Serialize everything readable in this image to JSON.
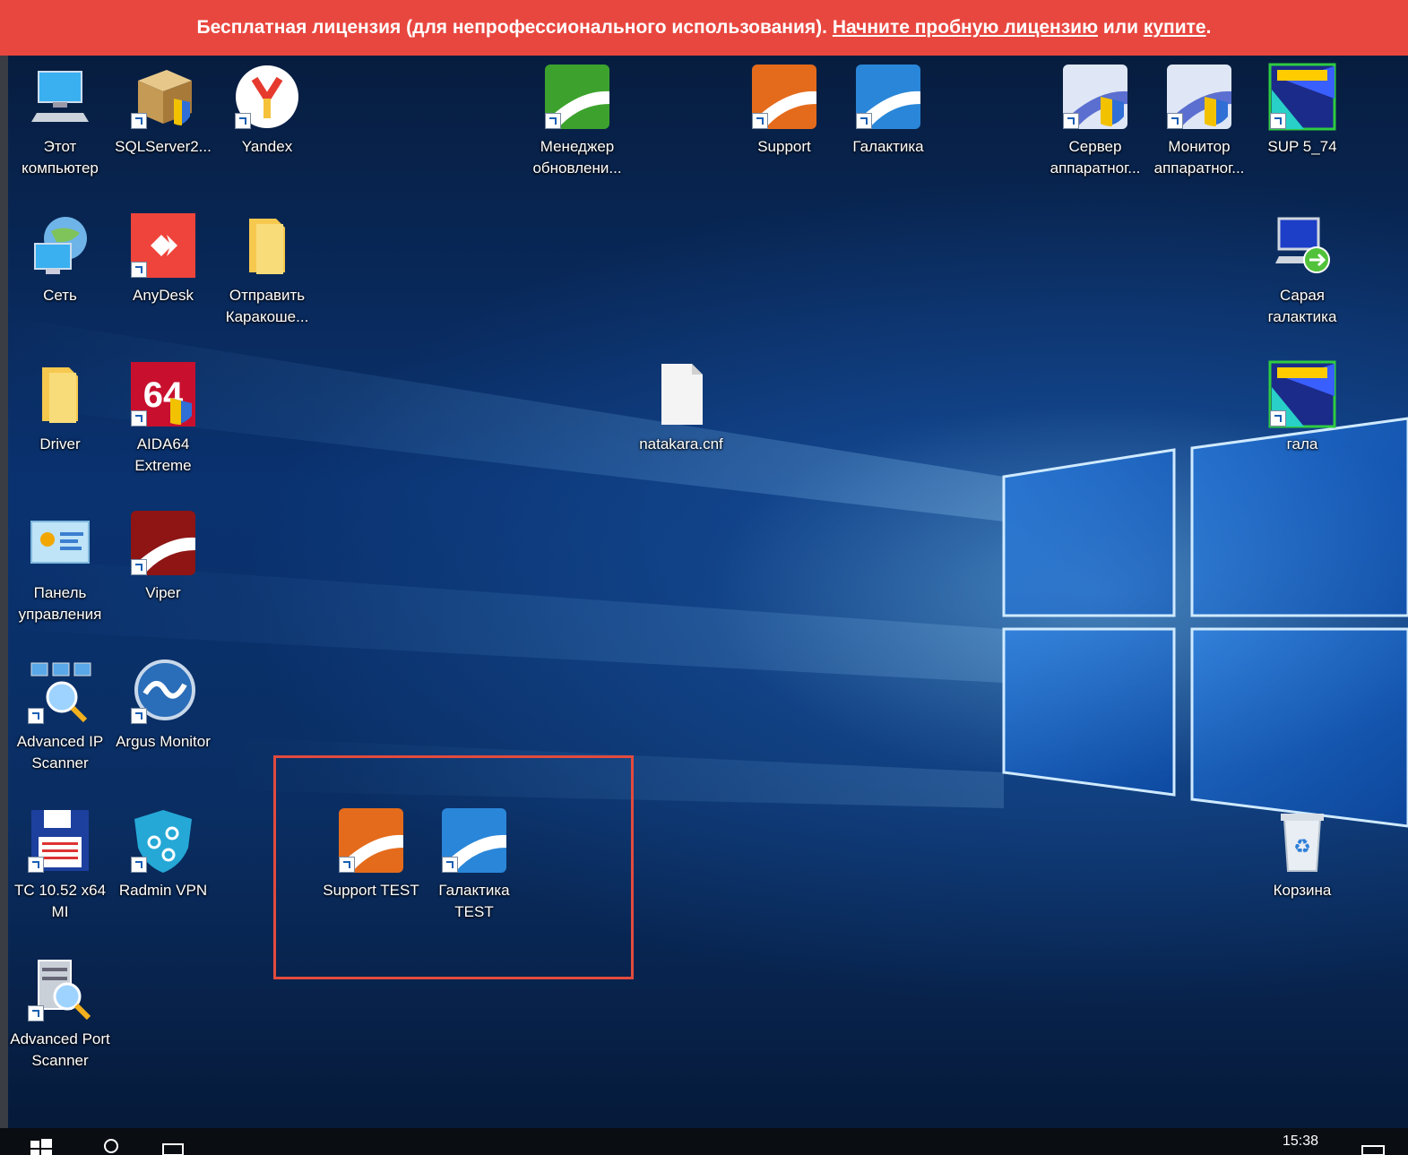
{
  "banner": {
    "text_pre": "Бесплатная лицензия (для непрофессионального использования). ",
    "link_trial": "Начните пробную лицензию",
    "text_mid": " или ",
    "link_buy": "купите",
    "text_post": "."
  },
  "desktop": {
    "icons": {
      "this_pc": "Этот компьютер",
      "sqlserver": "SQLServer2...",
      "yandex": "Yandex",
      "update_manager": "Менеджер обновлени...",
      "support": "Support",
      "galaktika": "Галактика",
      "hw_server": "Сервер аппаратног...",
      "hw_monitor": "Монитор аппаратног...",
      "sup574": "SUP 5_74",
      "network": "Сеть",
      "anydesk": "AnyDesk",
      "send_karakoshe": "Отправить Каракоше...",
      "saraya_galaktika": "Сарая галактика",
      "driver": "Driver",
      "aida64": "AIDA64 Extreme",
      "natakara": "natakara.cnf",
      "gala": "гала",
      "control_panel": "Панель управления",
      "viper": "Viper",
      "advanced_ip": "Advanced IP Scanner",
      "argus": "Argus Monitor",
      "support_test": "Support TEST",
      "galaktika_test": "Галактика TEST",
      "tc": "TC 10.52 x64 MI",
      "radmin": "Radmin VPN",
      "recycle": "Корзина",
      "advanced_port": "Advanced Port Scanner"
    }
  },
  "taskbar": {
    "clock": "15:38"
  }
}
